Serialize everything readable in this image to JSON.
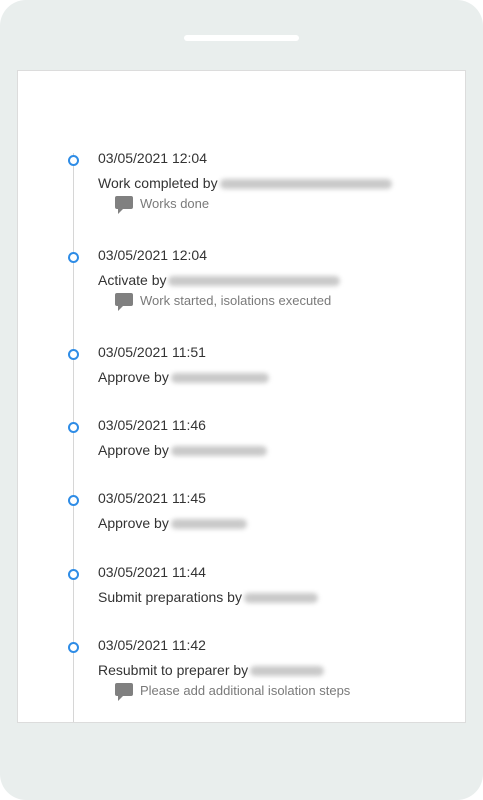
{
  "history": [
    {
      "date": "03/05/2021 12:04",
      "action": "Work completed by",
      "comment": "Works done"
    },
    {
      "date": "03/05/2021 12:04",
      "action": "Activate by",
      "comment": "Work started, isolations executed"
    },
    {
      "date": "03/05/2021 11:51",
      "action": "Approve by",
      "comment": ""
    },
    {
      "date": "03/05/2021 11:46",
      "action": "Approve by",
      "comment": ""
    },
    {
      "date": "03/05/2021 11:45",
      "action": "Approve by",
      "comment": ""
    },
    {
      "date": "03/05/2021 11:44",
      "action": "Submit preparations by",
      "comment": ""
    },
    {
      "date": "03/05/2021 11:42",
      "action": "Resubmit to preparer by",
      "comment": "Please add additional isolation steps"
    }
  ],
  "colors": {
    "dot": "#2e8ce6",
    "text": "#333333",
    "comment_text": "#7a7a7a",
    "frame": "#e9eeed"
  },
  "icons": {
    "timeline_marker": "circle-outline",
    "comment": "speech-bubble"
  }
}
